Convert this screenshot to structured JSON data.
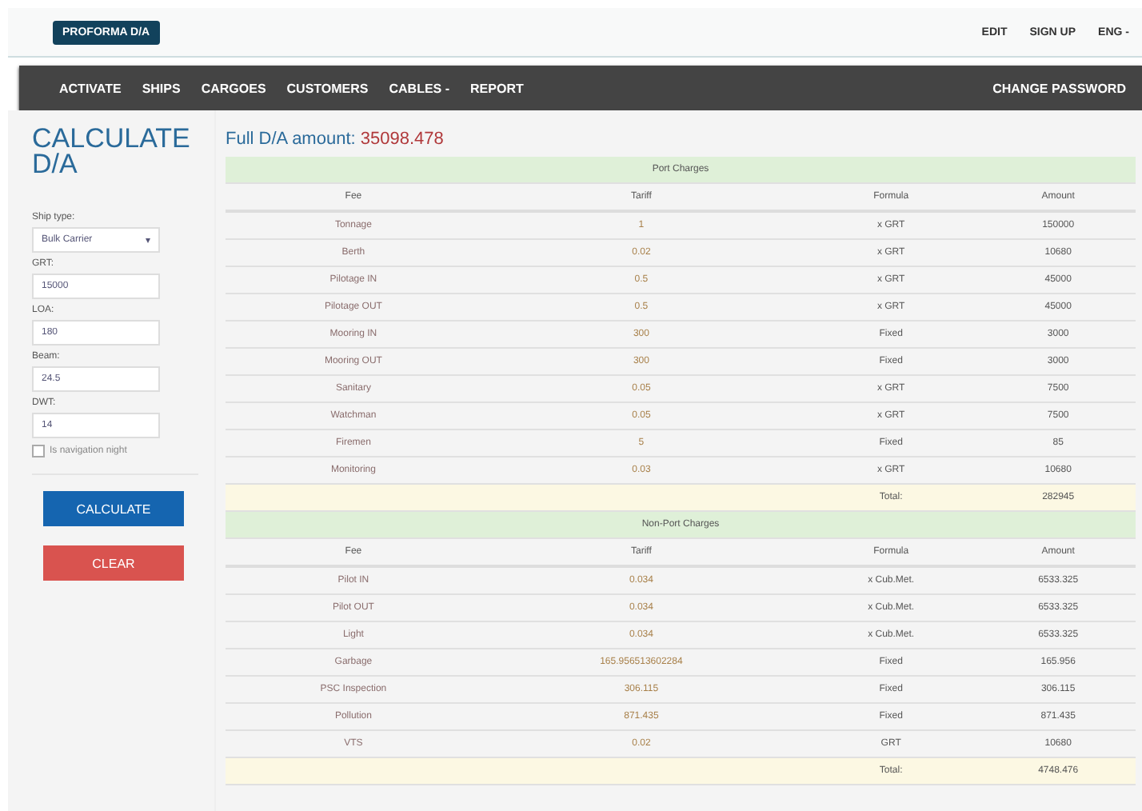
{
  "brand": "PROFORMA D/A",
  "top_links": [
    "EDIT",
    "SIGN UP",
    "ENG -"
  ],
  "nav": [
    "ACTIVATE",
    "SHIPS",
    "CARGOES",
    "CUSTOMERS",
    "CABLES -",
    "REPORT"
  ],
  "nav_right": "CHANGE PASSWORD",
  "title": "CALCULATE D/A",
  "form": {
    "fields": [
      {
        "label": "Ship type:",
        "kind": "select",
        "value": "Bulk Carrier",
        "caret": "▾"
      },
      {
        "label": "GRT:",
        "kind": "input",
        "value": "15000"
      },
      {
        "label": "LOA:",
        "kind": "input",
        "value": "180"
      },
      {
        "label": "Beam:",
        "kind": "input",
        "value": "24.5"
      },
      {
        "label": "DWT:",
        "kind": "input",
        "value": "14"
      }
    ],
    "checkbox": {
      "label": "Is navigation night",
      "checked": false
    },
    "buttons": [
      {
        "label": "CALCULATE",
        "kind": "primary"
      },
      {
        "label": "CLEAR",
        "kind": "danger"
      }
    ]
  },
  "full_amount": {
    "label": "Full D/A amount:",
    "value": "35098.478"
  },
  "sections": [
    {
      "title": "Port Charges",
      "columns": [
        "Fee",
        "Tariff",
        "Formula",
        "Amount"
      ],
      "rows": [
        [
          "Tonnage",
          "1",
          "x GRT",
          "150000"
        ],
        [
          "Berth",
          "0.02",
          "x GRT",
          "10680"
        ],
        [
          "Pilotage IN",
          "0.5",
          "x GRT",
          "45000"
        ],
        [
          "Pilotage OUT",
          "0.5",
          "x GRT",
          "45000"
        ],
        [
          "Mooring IN",
          "300",
          "Fixed",
          "3000"
        ],
        [
          "Mooring OUT",
          "300",
          "Fixed",
          "3000"
        ],
        [
          "Sanitary",
          "0.05",
          "x GRT",
          "7500"
        ],
        [
          "Watchman",
          "0.05",
          "x GRT",
          "7500"
        ],
        [
          "Firemen",
          "5",
          "Fixed",
          "85"
        ],
        [
          "Monitoring",
          "0.03",
          "x GRT",
          "10680"
        ]
      ],
      "total_label": "Total:",
      "total": "282945"
    },
    {
      "title": "Non-Port Charges",
      "columns": [
        "Fee",
        "Tariff",
        "Formula",
        "Amount"
      ],
      "rows": [
        [
          "Pilot IN",
          "0.034",
          "x Cub.Met.",
          "6533.325"
        ],
        [
          "Pilot OUT",
          "0.034",
          "x Cub.Met.",
          "6533.325"
        ],
        [
          "Light",
          "0.034",
          "x Cub.Met.",
          "6533.325"
        ],
        [
          "Garbage",
          "165.956513602284",
          "Fixed",
          "165.956"
        ],
        [
          "PSC Inspection",
          "306.115",
          "Fixed",
          "306.115"
        ],
        [
          "Pollution",
          "871.435",
          "Fixed",
          "871.435"
        ],
        [
          "VTS",
          "0.02",
          "GRT",
          "10680"
        ]
      ],
      "total_label": "Total:",
      "total": "4748.476"
    }
  ]
}
